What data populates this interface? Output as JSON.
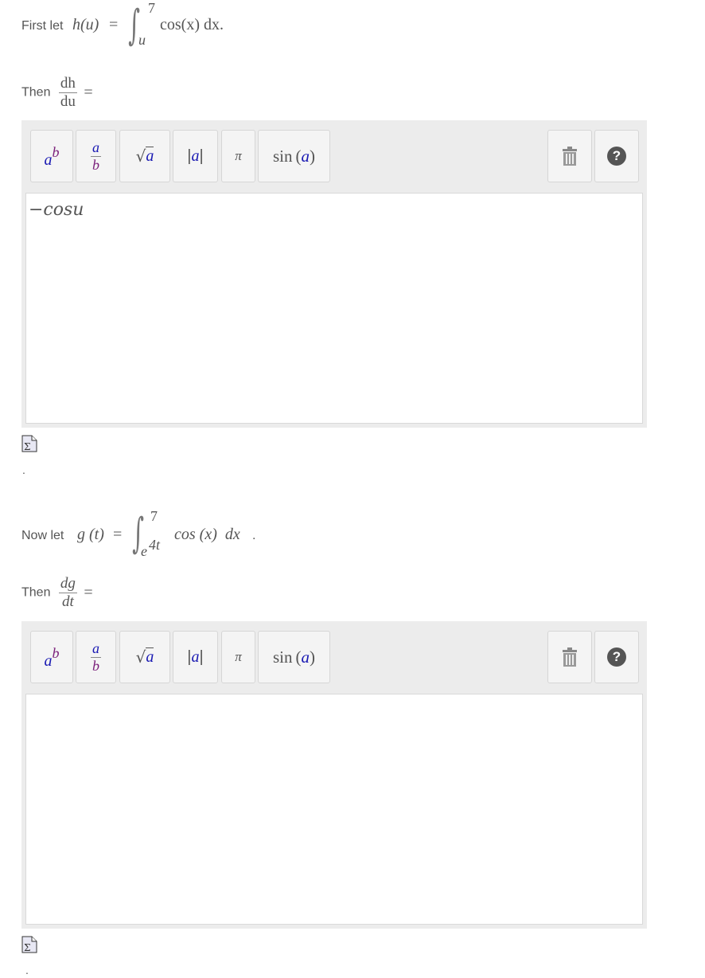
{
  "q1": {
    "intro": "First let",
    "func": "h(u)",
    "eq": "=",
    "upper": "7",
    "lower": "u",
    "integrand": "cos(x) dx.",
    "then": "Then",
    "d_num": "dh",
    "d_den": "du",
    "d_eq": "=",
    "answer": "−cosu",
    "after": "."
  },
  "q2": {
    "intro": "Now let",
    "func": "g (t)",
    "eq": "=",
    "upper": "7",
    "lower_base": "e",
    "lower_exp": "4t",
    "integrand": "cos (x)  dx",
    "period": ".",
    "then": "Then",
    "d_num": "dg",
    "d_den": "dt",
    "d_eq": "=",
    "answer": "",
    "after": "."
  },
  "toolbar": {
    "power_base": "a",
    "power_exp": "b",
    "frac_num": "a",
    "frac_den": "b",
    "sqrt_sym": "√",
    "sqrt_arg": "a",
    "abs_open": "|",
    "abs_arg": "a",
    "abs_close": "|",
    "pi": "π",
    "sin_fn": "sin",
    "sin_arg": "a",
    "help": "?"
  },
  "icons": {
    "trash": "trash-icon",
    "help": "help-icon",
    "equation": "equation-editor-icon"
  },
  "colors": {
    "blue": "#1a1ab3",
    "purple": "#7a1f7a",
    "editor_bg": "#ececec"
  }
}
